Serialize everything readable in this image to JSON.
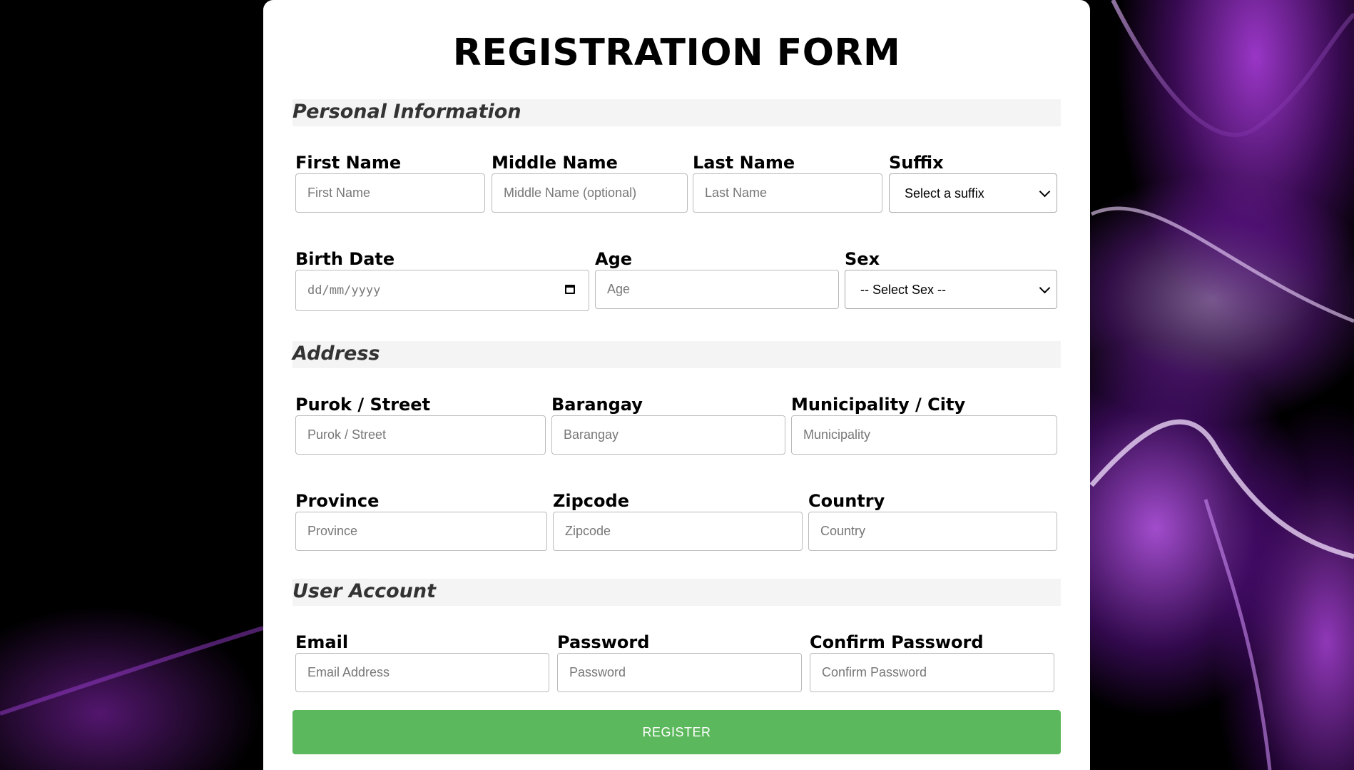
{
  "title": "REGISTRATION FORM",
  "sections": {
    "personal": "Personal Information",
    "address": "Address",
    "account": "User Account"
  },
  "personal": {
    "first_name": {
      "label": "First Name",
      "placeholder": "First Name"
    },
    "middle_name": {
      "label": "Middle Name",
      "placeholder": "Middle Name (optional)"
    },
    "last_name": {
      "label": "Last Name",
      "placeholder": "Last Name"
    },
    "suffix": {
      "label": "Suffix",
      "selected": "Select a suffix"
    },
    "birth_date": {
      "label": "Birth Date",
      "placeholder": "dd/mm/yyyy"
    },
    "age": {
      "label": "Age",
      "placeholder": "Age"
    },
    "sex": {
      "label": "Sex",
      "selected": "-- Select Sex --"
    }
  },
  "address": {
    "street": {
      "label": "Purok / Street",
      "placeholder": "Purok / Street"
    },
    "barangay": {
      "label": "Barangay",
      "placeholder": "Barangay"
    },
    "city": {
      "label": "Municipality / City",
      "placeholder": "Municipality"
    },
    "province": {
      "label": "Province",
      "placeholder": "Province"
    },
    "zipcode": {
      "label": "Zipcode",
      "placeholder": "Zipcode"
    },
    "country": {
      "label": "Country",
      "placeholder": "Country"
    }
  },
  "account": {
    "email": {
      "label": "Email",
      "placeholder": "Email Address"
    },
    "password": {
      "label": "Password",
      "placeholder": "Password"
    },
    "confirm_password": {
      "label": "Confirm Password",
      "placeholder": "Confirm Password"
    }
  },
  "register_label": "REGISTER",
  "colors": {
    "register_button": "#5cb85c",
    "section_bg": "#f4f4f4",
    "background_accent": "#a83ce0"
  }
}
